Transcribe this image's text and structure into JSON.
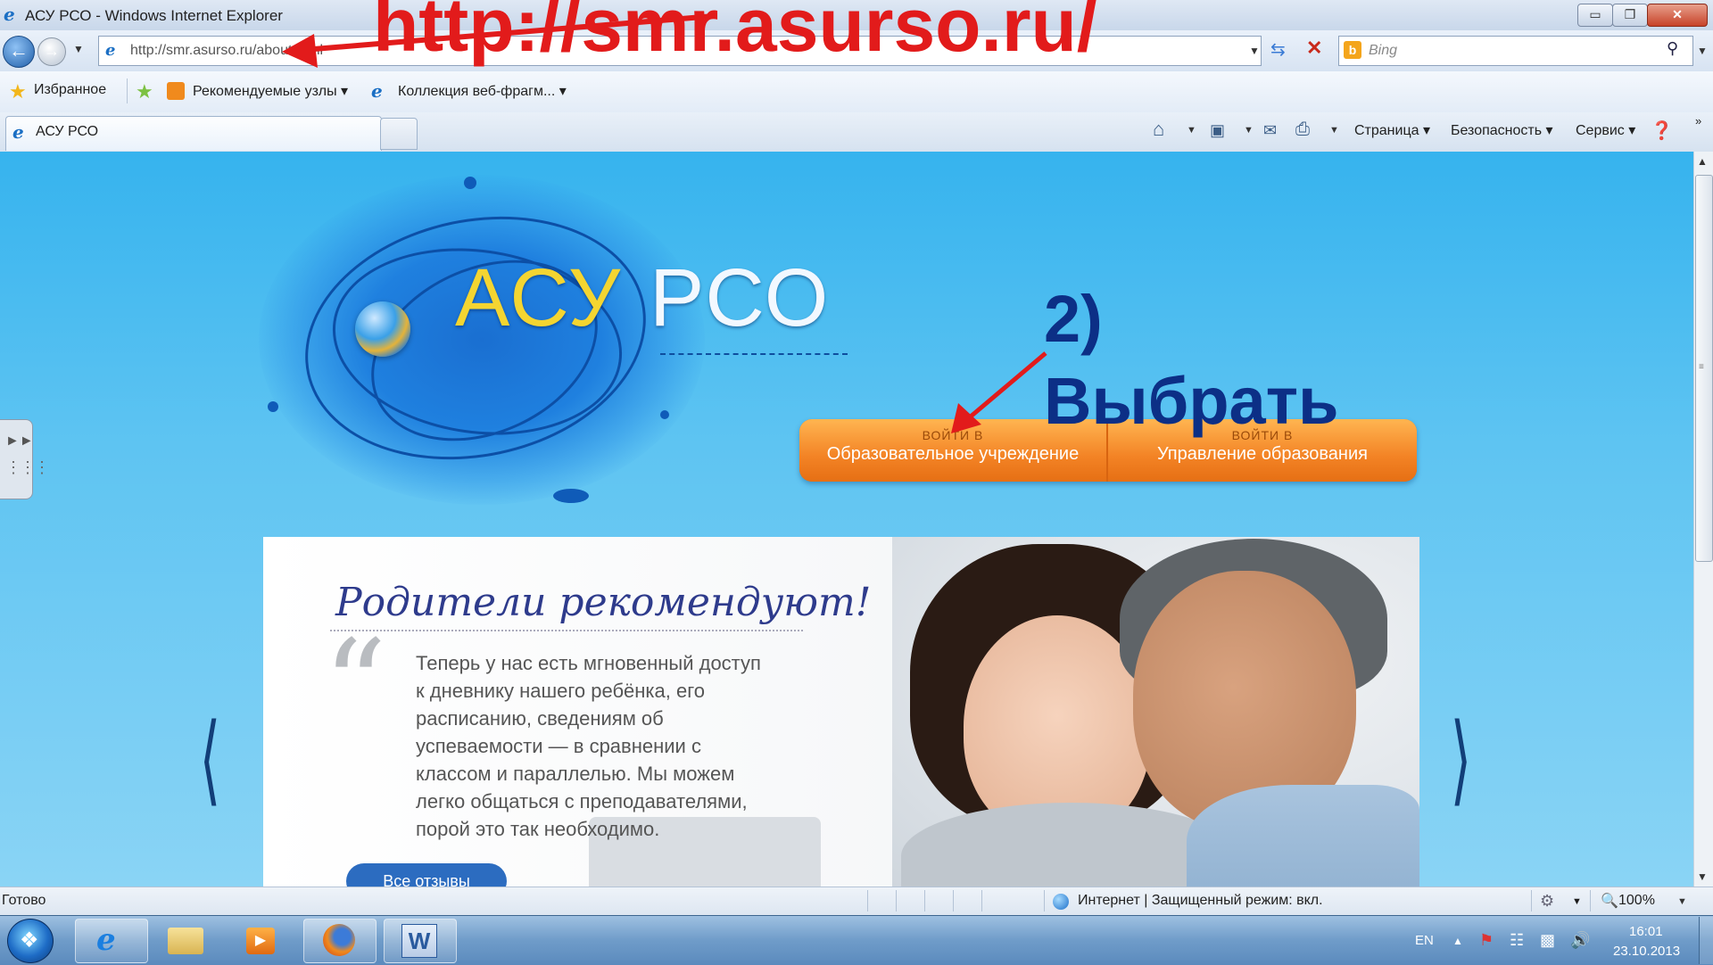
{
  "window": {
    "title": "АСУ РСО - Windows Internet Explorer",
    "minimize": "▭",
    "maximize": "❐",
    "close": "✕"
  },
  "address_bar": {
    "url": "http://smr.asurso.ru/about.html",
    "search_placeholder": "Bing"
  },
  "favorites_bar": {
    "favorites_label": "Избранное",
    "suggested_sites": "Рекомендуемые узлы ▾",
    "web_slices": "Коллекция веб-фрагм... ▾"
  },
  "tabs": [
    {
      "label": "АСУ РСО",
      "active": true
    }
  ],
  "command_bar": {
    "page": "Страница ▾",
    "safety": "Безопасность ▾",
    "tools": "Сервис ▾"
  },
  "page": {
    "logo_part1": "АСУ",
    "logo_part2": "РСО",
    "login_school_small": "ВОЙТИ В",
    "login_school_main": "Образовательное учреждение",
    "login_mgmt_small": "ВОЙТИ В",
    "login_mgmt_main": "Управление образования",
    "carousel": {
      "title": "Родители рекомендуют!",
      "quote": "Теперь у нас есть мгновенный доступ к дневнику нашего ребёнка, его расписанию, сведениям об успеваемости — в сравнении с классом и параллелью. Мы можем легко общаться с преподавателями, порой это так необходимо.",
      "all_reviews": "Все отзывы"
    }
  },
  "annotations": {
    "url": "http://smr.asurso.ru/",
    "step": "2) Выбрать"
  },
  "status_bar": {
    "status": "Готово",
    "zone": "Интернет | Защищенный режим: вкл.",
    "zoom": "100%"
  },
  "taskbar": {
    "language": "EN",
    "time": "16:01",
    "date": "23.10.2013",
    "pinned": [
      "Internet Explorer",
      "Проводник",
      "Windows Media Player",
      "Firefox",
      "Word"
    ]
  },
  "colors": {
    "page_bg": "#36b3ee",
    "login_orange": "#f38325",
    "annotation_red": "#e21b1b",
    "annotation_navy": "#0c2f86"
  }
}
